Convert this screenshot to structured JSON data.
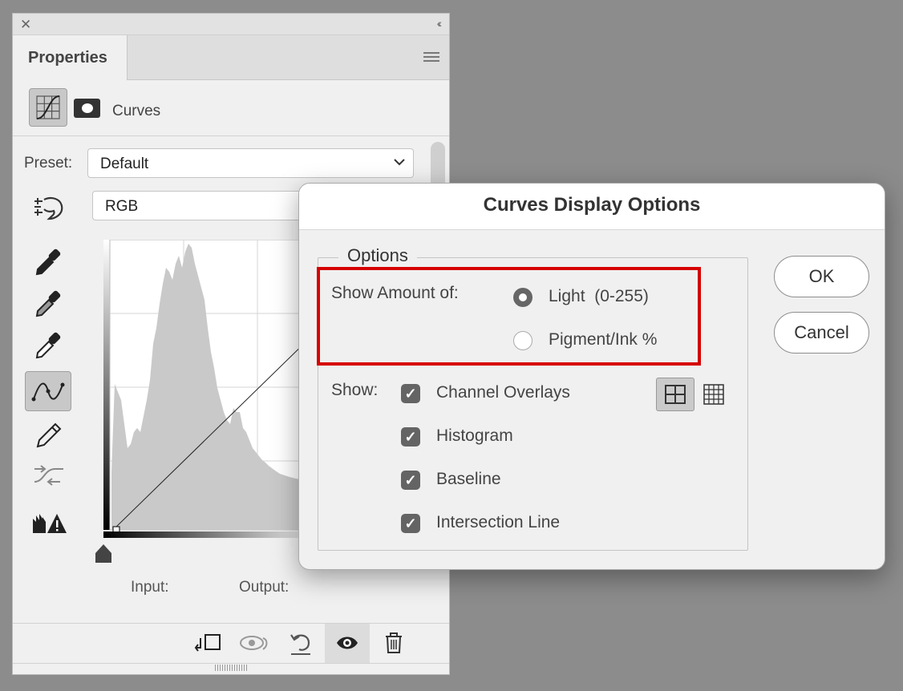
{
  "panel": {
    "title": "Properties",
    "adjustment_label": "Curves",
    "preset_label": "Preset:",
    "preset_value": "Default",
    "channel_value": "RGB",
    "input_label": "Input:",
    "output_label": "Output:",
    "icons": [
      "close-icon",
      "collapse-icon",
      "panel-menu-icon",
      "curves-adjustment-icon",
      "mask-icon",
      "on-image-adjust-icon",
      "black-point-eyedropper-icon",
      "gray-point-eyedropper-icon",
      "white-point-eyedropper-icon",
      "curve-point-tool-icon",
      "pencil-icon",
      "smooth-curve-icon",
      "clipping-warning-icon",
      "clip-to-layer-icon",
      "view-previous-icon",
      "reset-icon",
      "visibility-icon",
      "trash-icon"
    ]
  },
  "dialog": {
    "title": "Curves Display Options",
    "options_legend": "Options",
    "show_amount_label": "Show Amount of:",
    "radio_options": [
      {
        "label": "Light  (0-255)",
        "selected": true
      },
      {
        "label": "Pigment/Ink %",
        "selected": false
      }
    ],
    "show_label": "Show:",
    "checkboxes": [
      {
        "label": "Channel Overlays",
        "checked": true
      },
      {
        "label": "Histogram",
        "checked": true
      },
      {
        "label": "Baseline",
        "checked": true
      },
      {
        "label": "Intersection Line",
        "checked": true
      }
    ],
    "ok_label": "OK",
    "cancel_label": "Cancel"
  },
  "colors": {
    "highlight_border": "#d60000",
    "background": "#8c8c8c",
    "panel": "#f0f0f0"
  }
}
